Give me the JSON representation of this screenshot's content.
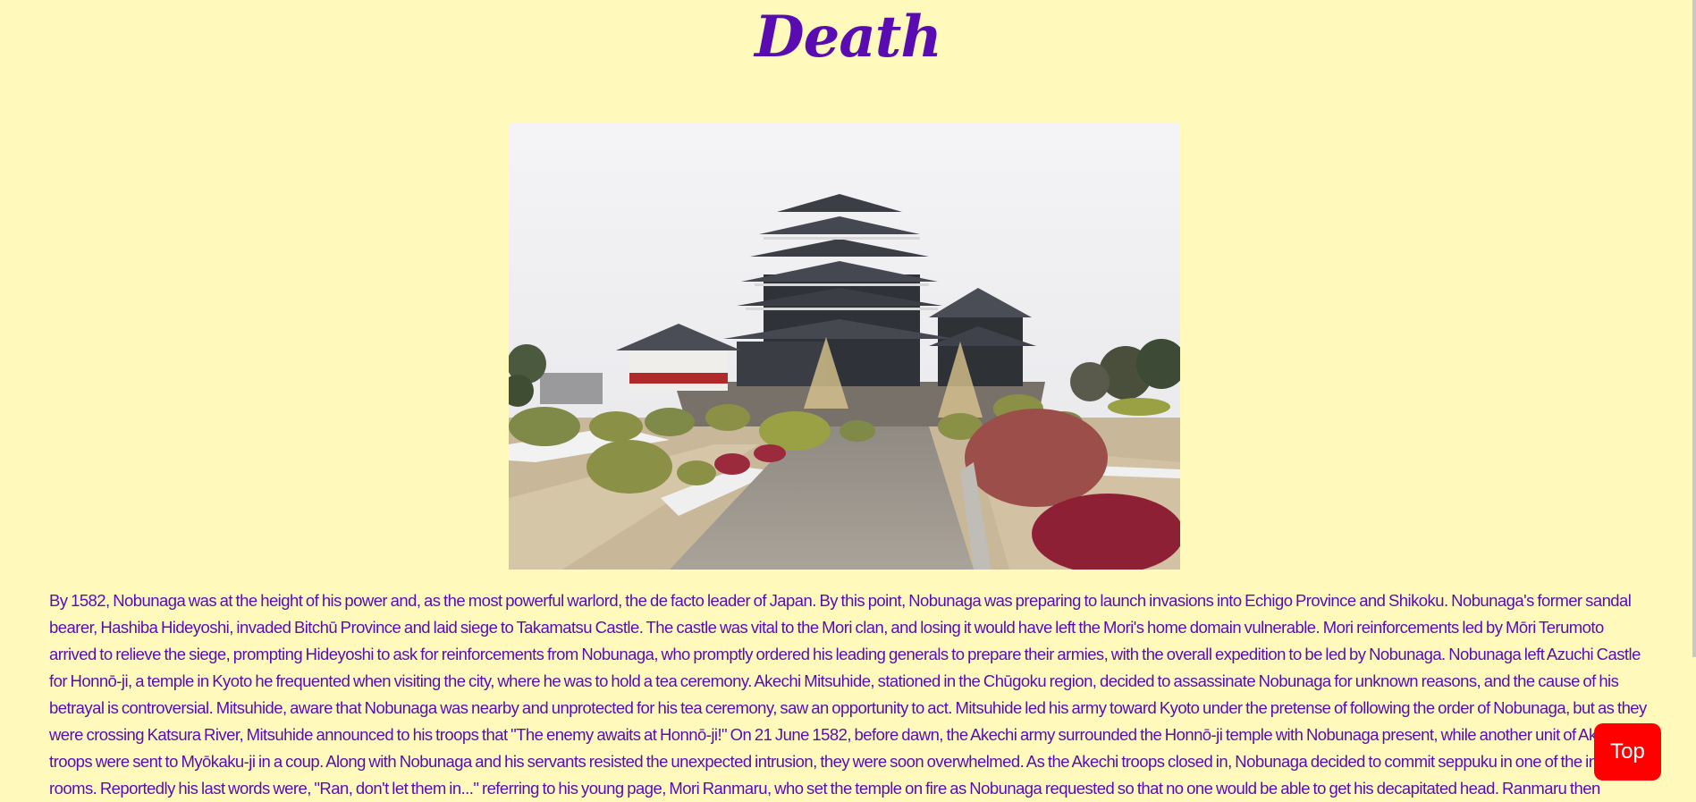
{
  "heading": {
    "title": "Death"
  },
  "image": {
    "subject": "castle-photo"
  },
  "article": {
    "paragraph": "By 1582, Nobunaga was at the height of his power and, as the most powerful warlord, the de facto leader of Japan. By this point, Nobunaga was preparing to launch invasions into Echigo Province and Shikoku. Nobunaga's former sandal bearer, Hashiba Hideyoshi, invaded Bitchū Province and laid siege to Takamatsu Castle. The castle was vital to the Mori clan, and losing it would have left the Mori's home domain vulnerable. Mori reinforcements led by Mōri Terumoto arrived to relieve the siege, prompting Hideyoshi to ask for reinforcements from Nobunaga, who promptly ordered his leading generals to prepare their armies, with the overall expedition to be led by Nobunaga. Nobunaga left Azuchi Castle for Honnō-ji, a temple in Kyoto he frequented when visiting the city, where he was to hold a tea ceremony. Akechi Mitsuhide, stationed in the Chūgoku region, decided to assassinate Nobunaga for unknown reasons, and the cause of his betrayal is controversial. Mitsuhide, aware that Nobunaga was nearby and unprotected for his tea ceremony, saw an opportunity to act. Mitsuhide led his army toward Kyoto under the pretense of following the order of Nobunaga, but as they were crossing Katsura River, Mitsuhide announced to his troops that \"The enemy awaits at Honnō-ji!\" On 21 June 1582, before dawn, the Akechi army surrounded the Honnō-ji temple with Nobunaga present, while another unit of Akechi troops were sent to Myōkaku-ji in a coup. Along with Nobunaga and his servants resisted the unexpected intrusion, they were soon overwhelmed. As the Akechi troops closed in, Nobunaga decided to commit seppuku in one of the inner rooms. Reportedly his last words were, \"Ran, don't let them in...\" referring to his young page, Mori Ranmaru, who set the temple on fire as Nobunaga requested so that no one would be able to get his decapitated head. Ranmaru then followed his lord, with his loyalty and devotion making him a revered"
  },
  "controls": {
    "top_label": "Top"
  },
  "colors": {
    "background": "#fffabb",
    "text": "#5a0cb3",
    "button": "#ff0000",
    "button_text": "#ffffff"
  }
}
